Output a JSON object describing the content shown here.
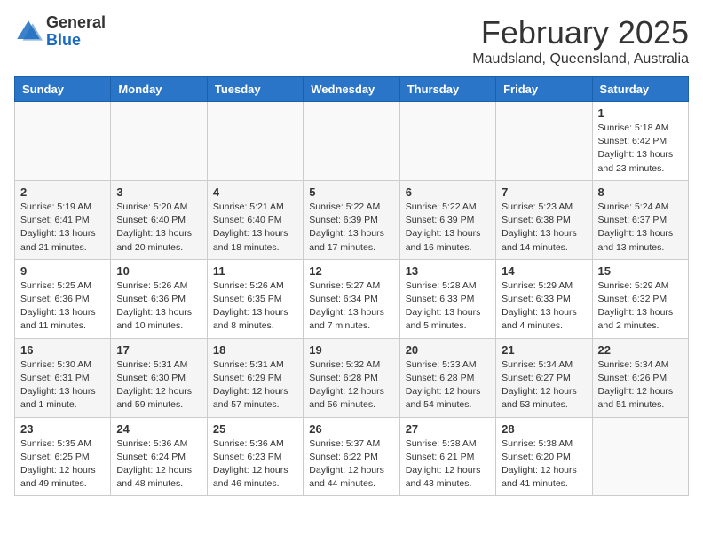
{
  "header": {
    "logo_general": "General",
    "logo_blue": "Blue",
    "month": "February 2025",
    "location": "Maudsland, Queensland, Australia"
  },
  "weekdays": [
    "Sunday",
    "Monday",
    "Tuesday",
    "Wednesday",
    "Thursday",
    "Friday",
    "Saturday"
  ],
  "weeks": [
    [
      {
        "day": "",
        "info": ""
      },
      {
        "day": "",
        "info": ""
      },
      {
        "day": "",
        "info": ""
      },
      {
        "day": "",
        "info": ""
      },
      {
        "day": "",
        "info": ""
      },
      {
        "day": "",
        "info": ""
      },
      {
        "day": "1",
        "info": "Sunrise: 5:18 AM\nSunset: 6:42 PM\nDaylight: 13 hours\nand 23 minutes."
      }
    ],
    [
      {
        "day": "2",
        "info": "Sunrise: 5:19 AM\nSunset: 6:41 PM\nDaylight: 13 hours\nand 21 minutes."
      },
      {
        "day": "3",
        "info": "Sunrise: 5:20 AM\nSunset: 6:40 PM\nDaylight: 13 hours\nand 20 minutes."
      },
      {
        "day": "4",
        "info": "Sunrise: 5:21 AM\nSunset: 6:40 PM\nDaylight: 13 hours\nand 18 minutes."
      },
      {
        "day": "5",
        "info": "Sunrise: 5:22 AM\nSunset: 6:39 PM\nDaylight: 13 hours\nand 17 minutes."
      },
      {
        "day": "6",
        "info": "Sunrise: 5:22 AM\nSunset: 6:39 PM\nDaylight: 13 hours\nand 16 minutes."
      },
      {
        "day": "7",
        "info": "Sunrise: 5:23 AM\nSunset: 6:38 PM\nDaylight: 13 hours\nand 14 minutes."
      },
      {
        "day": "8",
        "info": "Sunrise: 5:24 AM\nSunset: 6:37 PM\nDaylight: 13 hours\nand 13 minutes."
      }
    ],
    [
      {
        "day": "9",
        "info": "Sunrise: 5:25 AM\nSunset: 6:36 PM\nDaylight: 13 hours\nand 11 minutes."
      },
      {
        "day": "10",
        "info": "Sunrise: 5:26 AM\nSunset: 6:36 PM\nDaylight: 13 hours\nand 10 minutes."
      },
      {
        "day": "11",
        "info": "Sunrise: 5:26 AM\nSunset: 6:35 PM\nDaylight: 13 hours\nand 8 minutes."
      },
      {
        "day": "12",
        "info": "Sunrise: 5:27 AM\nSunset: 6:34 PM\nDaylight: 13 hours\nand 7 minutes."
      },
      {
        "day": "13",
        "info": "Sunrise: 5:28 AM\nSunset: 6:33 PM\nDaylight: 13 hours\nand 5 minutes."
      },
      {
        "day": "14",
        "info": "Sunrise: 5:29 AM\nSunset: 6:33 PM\nDaylight: 13 hours\nand 4 minutes."
      },
      {
        "day": "15",
        "info": "Sunrise: 5:29 AM\nSunset: 6:32 PM\nDaylight: 13 hours\nand 2 minutes."
      }
    ],
    [
      {
        "day": "16",
        "info": "Sunrise: 5:30 AM\nSunset: 6:31 PM\nDaylight: 13 hours\nand 1 minute."
      },
      {
        "day": "17",
        "info": "Sunrise: 5:31 AM\nSunset: 6:30 PM\nDaylight: 12 hours\nand 59 minutes."
      },
      {
        "day": "18",
        "info": "Sunrise: 5:31 AM\nSunset: 6:29 PM\nDaylight: 12 hours\nand 57 minutes."
      },
      {
        "day": "19",
        "info": "Sunrise: 5:32 AM\nSunset: 6:28 PM\nDaylight: 12 hours\nand 56 minutes."
      },
      {
        "day": "20",
        "info": "Sunrise: 5:33 AM\nSunset: 6:28 PM\nDaylight: 12 hours\nand 54 minutes."
      },
      {
        "day": "21",
        "info": "Sunrise: 5:34 AM\nSunset: 6:27 PM\nDaylight: 12 hours\nand 53 minutes."
      },
      {
        "day": "22",
        "info": "Sunrise: 5:34 AM\nSunset: 6:26 PM\nDaylight: 12 hours\nand 51 minutes."
      }
    ],
    [
      {
        "day": "23",
        "info": "Sunrise: 5:35 AM\nSunset: 6:25 PM\nDaylight: 12 hours\nand 49 minutes."
      },
      {
        "day": "24",
        "info": "Sunrise: 5:36 AM\nSunset: 6:24 PM\nDaylight: 12 hours\nand 48 minutes."
      },
      {
        "day": "25",
        "info": "Sunrise: 5:36 AM\nSunset: 6:23 PM\nDaylight: 12 hours\nand 46 minutes."
      },
      {
        "day": "26",
        "info": "Sunrise: 5:37 AM\nSunset: 6:22 PM\nDaylight: 12 hours\nand 44 minutes."
      },
      {
        "day": "27",
        "info": "Sunrise: 5:38 AM\nSunset: 6:21 PM\nDaylight: 12 hours\nand 43 minutes."
      },
      {
        "day": "28",
        "info": "Sunrise: 5:38 AM\nSunset: 6:20 PM\nDaylight: 12 hours\nand 41 minutes."
      },
      {
        "day": "",
        "info": ""
      }
    ]
  ]
}
